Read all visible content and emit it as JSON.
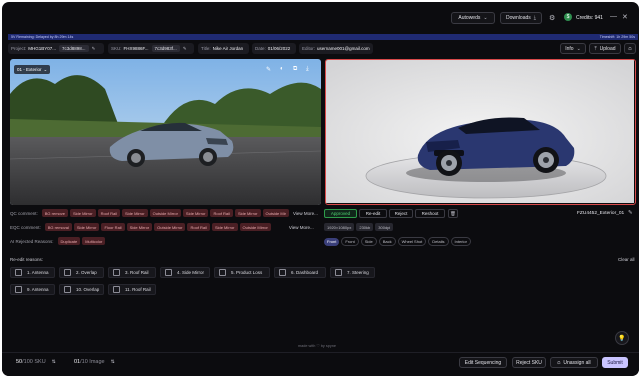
{
  "topbar": {
    "autoweds_label": "Autoweds",
    "downloads_label": "Downloads",
    "credits_label": "Credits: 941"
  },
  "strip": {
    "left": "5V Remaining: Delayed by 8h 29m 14s",
    "right": "Timeshift: 1h 29m 50s"
  },
  "info": {
    "project_label": "Project:",
    "project_value": "MHG1BY07...",
    "project_chip": "7c3d8898...",
    "sku_label": "SKU:",
    "sku_value": "FHX9886F...",
    "sku_chip": "7c3d983f...",
    "title_label": "Title:",
    "title_value": "Nike Air Jordan",
    "date_label": "Date:",
    "date_value": "01/06/2022",
    "editor_label": "Editor:",
    "editor_value": "username001@gmail.com",
    "info_btn": "Info",
    "upload_btn": "Upload"
  },
  "image": {
    "left_selector": "01 - Exterior"
  },
  "qc": {
    "label": "QC comment:",
    "tags": [
      "BG remove",
      "Side Mirror",
      "Roof Rail",
      "Side Mirror",
      "Outside Mirror",
      "Side Mirror",
      "Roof Rail",
      "Side Mirror",
      "Outside Mir"
    ],
    "view_more": "View More...",
    "approved": "Approved",
    "reedit": "Re-edit",
    "reject": "Reject",
    "reshoot": "Reshoot",
    "filename": "FZU4452_Exterior_01"
  },
  "eqc": {
    "label": "EQC comment:",
    "tags": [
      "BG removal",
      "Side Mirror",
      "Floor Rail",
      "Side Mirror",
      "Outside Mirror",
      "Roof Rail",
      "Side Mirror",
      "Outside Mirror"
    ],
    "view_more": "View More...",
    "sizes": [
      "1920×1080px",
      "230kb",
      "300dpi"
    ]
  },
  "ai": {
    "label": "AI Rejected Reasons:",
    "tags": [
      "Duplicate",
      "Multicolor"
    ],
    "views": [
      "Front",
      "Front",
      "Side",
      "Back",
      "Wheel Shot",
      "Details",
      "Interior"
    ]
  },
  "reedit": {
    "title": "Re-edit reasons:",
    "clear_all": "Clear all",
    "reasons": [
      "1. Antenna",
      "2. Overlap",
      "3. Roof Rail",
      "4. Side Mirror",
      "5. Product Loss",
      "6. Dashboard",
      "7. Steering",
      "9. Antenna",
      "10. Overlap",
      "11. Roof Rail"
    ]
  },
  "footer_note": "made with ♡ by spyne",
  "bottom": {
    "sku_count": "50",
    "sku_total": "/100 SKU",
    "image_count": "01",
    "image_total": "/10 Image",
    "edit_sequencing": "Edit Sequencing",
    "reject_sku": "Reject SKU",
    "unassign_all": "Unassign all",
    "submit": "Submit"
  },
  "colors": {
    "accent": "#7a6cf0",
    "approved": "#2e9c4a",
    "reject_border": "#d94a4a"
  }
}
